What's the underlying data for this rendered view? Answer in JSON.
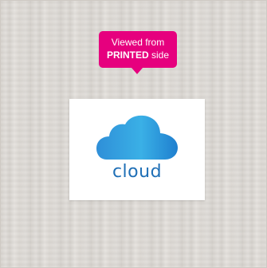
{
  "tooltip": {
    "line1": "Viewed from",
    "line2_bold": "PRINTED",
    "line2_rest": " side",
    "color": "#e6007e"
  },
  "label": {
    "brand": "cloud",
    "icon": "cloud-icon",
    "brand_color": "#1f6fb6"
  }
}
